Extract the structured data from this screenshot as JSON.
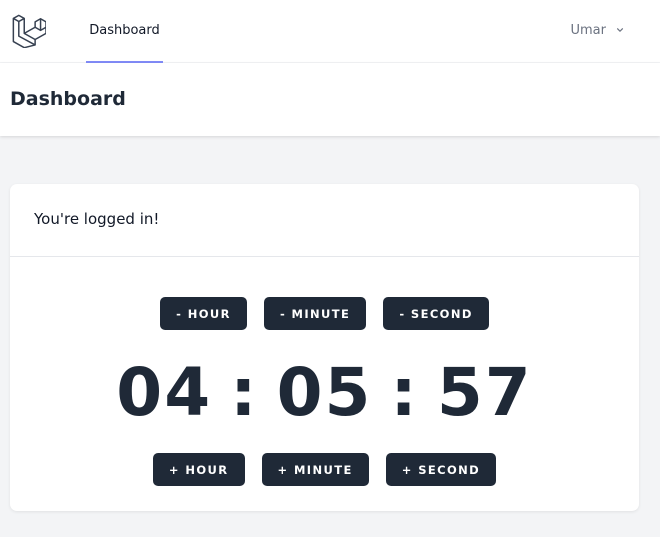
{
  "nav": {
    "active_link": "Dashboard",
    "user_name": "Umar"
  },
  "header": {
    "title": "Dashboard"
  },
  "card": {
    "message": "You're logged in!"
  },
  "controls": {
    "minus_hour": "- Hour",
    "minus_minute": "- Minute",
    "minus_second": "- Second",
    "plus_hour": "+ Hour",
    "plus_minute": "+ Minute",
    "plus_second": "+ Second"
  },
  "timer": {
    "hours": "04",
    "minutes": "05",
    "seconds": "57",
    "separator": ":"
  },
  "colors": {
    "accent": "#818cf8",
    "button_bg": "#1f2937",
    "page_bg": "#f3f4f6"
  }
}
